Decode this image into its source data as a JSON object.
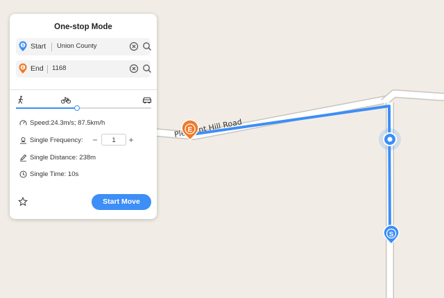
{
  "panel": {
    "title": "One-stop Mode",
    "start": {
      "label": "Start",
      "value": "Union County",
      "pin_letter": "S",
      "pin_color": "#3d8ef7"
    },
    "end": {
      "label": "End",
      "value": "1168",
      "pin_letter": "E",
      "pin_color": "#f07a28"
    },
    "modes": [
      "walk-icon",
      "bike-icon",
      "car-icon"
    ],
    "speed_slider_level": 0.45,
    "speed": "Speed:24.3m/s; 87.5km/h",
    "frequency_label": "Single Frequency:",
    "frequency_value": "1",
    "distance": "Single Distance: 238m",
    "time": "Single Time: 10s",
    "start_move_label": "Start Move"
  },
  "map": {
    "road_name": "Pleasant Hill Road",
    "end_marker_letter": "E",
    "start_marker_letter": "S",
    "route_color": "#3d8ef7",
    "background_color": "#f1ede6"
  }
}
